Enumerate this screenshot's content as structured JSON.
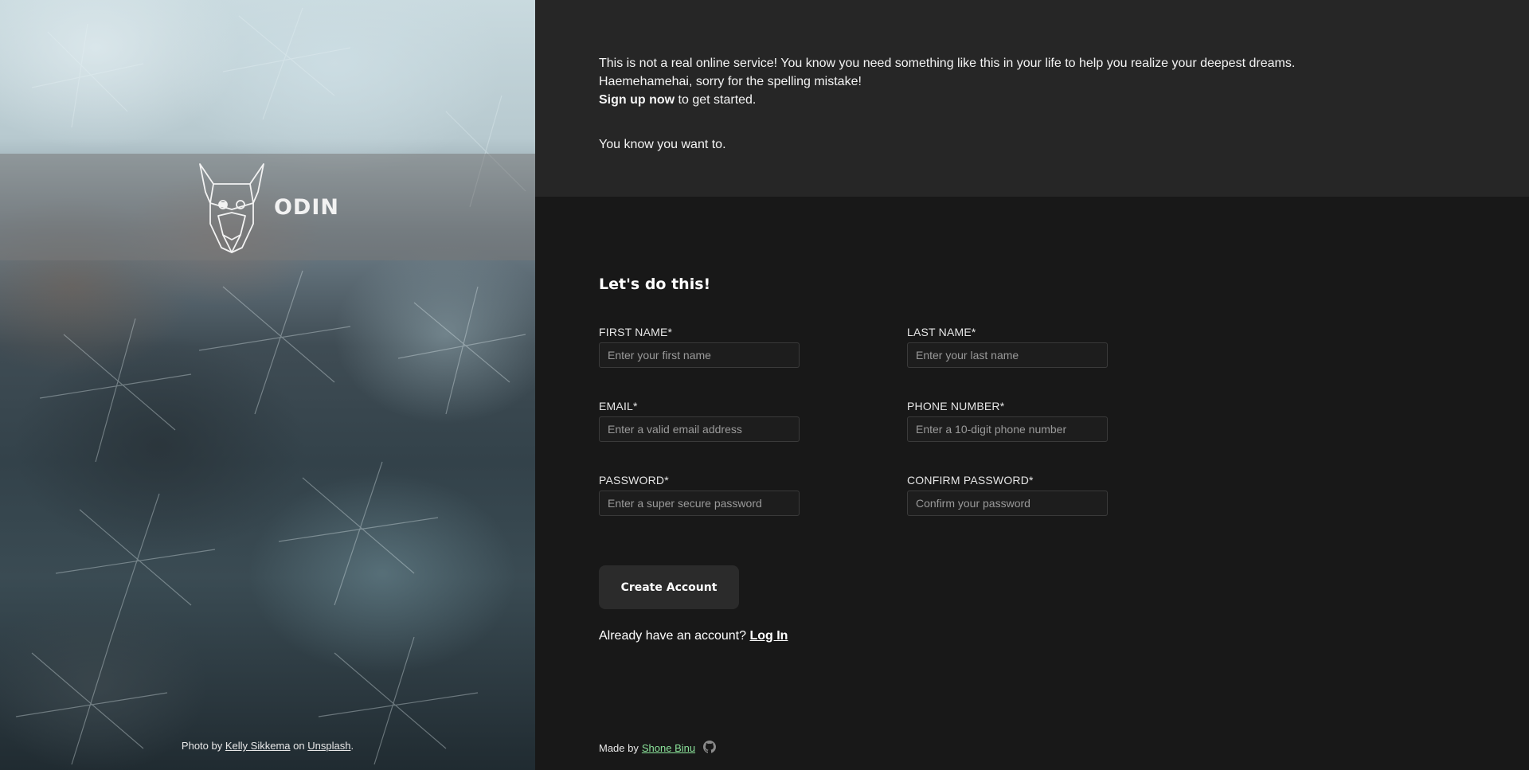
{
  "brand": {
    "name": "ODIN"
  },
  "photo_credit": {
    "prefix": "Photo by",
    "author": "Kelly Sikkema",
    "middle": "on",
    "site": "Unsplash",
    "suffix": "."
  },
  "intro": {
    "line1": "This is not a real online service! You know you need something like this in your life to help you realize your deepest dreams.",
    "line2": "Haemehamehai, sorry for the spelling mistake!",
    "signup_bold": "Sign up now",
    "signup_rest": " to get started.",
    "line4": "You know you want to."
  },
  "form": {
    "title": "Let's do this!",
    "fields": [
      {
        "label": "FIRST NAME*",
        "placeholder": "Enter your first name",
        "value": ""
      },
      {
        "label": "LAST NAME*",
        "placeholder": "Enter your last name",
        "value": ""
      },
      {
        "label": "EMAIL*",
        "placeholder": "Enter a valid email address",
        "value": ""
      },
      {
        "label": "PHONE NUMBER*",
        "placeholder": "Enter a 10-digit phone number",
        "value": ""
      },
      {
        "label": "PASSWORD*",
        "placeholder": "Enter a super secure password",
        "value": ""
      },
      {
        "label": "CONFIRM PASSWORD*",
        "placeholder": "Confirm your password",
        "value": ""
      }
    ],
    "submit_label": "Create Account",
    "login_prompt": "Already have an account?",
    "login_link": "Log In"
  },
  "footer": {
    "made_by": "Made by",
    "author": "Shone Binu",
    "icon": "github-icon"
  },
  "colors": {
    "left_band": "#787878",
    "intro_bg": "#262626",
    "page_bg": "#181818",
    "button_bg": "#2b2b2b",
    "author_link": "#8be39a"
  }
}
